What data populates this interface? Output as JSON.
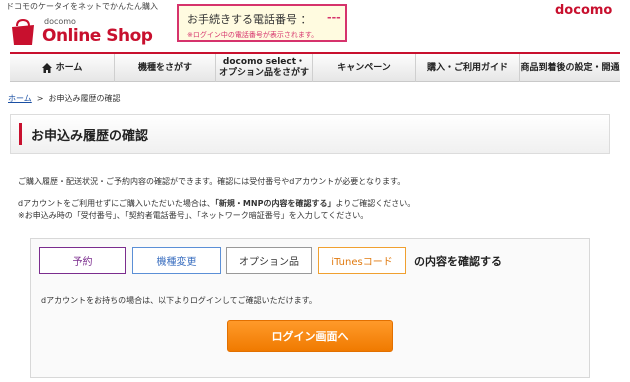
{
  "header": {
    "tagline": "ドコモのケータイをネットでかんたん購入",
    "logo_small": "docomo",
    "logo_big": "Online Shop",
    "brand": "docomo",
    "phone_box": {
      "title": "お手続きする電話番号 ：",
      "value": "---",
      "note": "※ログイン中の電話番号が表示されます。"
    },
    "accent_color": "#c8102e"
  },
  "nav": {
    "items": [
      {
        "label": "ホーム",
        "icon": "home-icon"
      },
      {
        "label": "機種をさがす"
      },
      {
        "label1": "docomo select・",
        "label2": "オプション品をさがす"
      },
      {
        "label": "キャンペーン"
      },
      {
        "label": "購入・ご利用ガイド"
      },
      {
        "label": "商品到着後の設定・開通"
      }
    ]
  },
  "breadcrumb": {
    "home": "ホーム",
    "separator": ">",
    "current": "お申込み履歴の確認"
  },
  "page": {
    "title": "お申込み履歴の確認",
    "desc1": "ご購入履歴・配送状況・ご予約内容の確認ができます。確認には受付番号やdアカウントが必要となります。",
    "desc2_pre": "dアカウントをご利用せずにご購入いただいた場合は、",
    "desc2_bold": "「新規・MNPの内容を確認する」",
    "desc2_post": "よりご確認ください。",
    "desc3": "※お申込み時の「受付番号」、「契約者電話番号」、「ネットワーク暗証番号」を入力してください。"
  },
  "panel": {
    "tabs": {
      "reserve": "予約",
      "device": "機種変更",
      "option": "オプション品",
      "itunes": "iTunesコード"
    },
    "suffix": "の内容を確認する",
    "login_note": "dアカウントをお持ちの場合は、以下よりログインしてご確認いただけます。",
    "login_button": "ログイン画面へ"
  }
}
